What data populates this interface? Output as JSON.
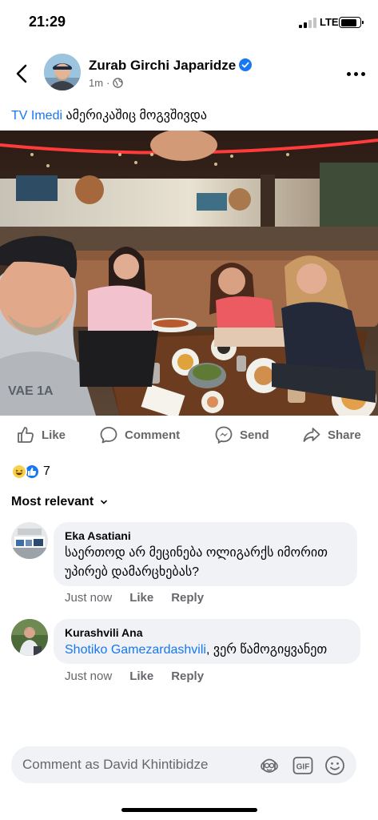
{
  "status_bar": {
    "time": "21:29",
    "network": "LTE"
  },
  "post": {
    "author": "Zurab Girchi Japaridze",
    "meta_time": "1m",
    "tag_text": "TV Imedi",
    "body_text": " ამერიკაშიც მოგვშივდა",
    "actions": {
      "like": "Like",
      "comment": "Comment",
      "send": "Send",
      "share": "Share"
    },
    "reaction_count": "7",
    "sort_label": "Most relevant"
  },
  "comments": [
    {
      "author": "Eka Asatiani",
      "text": "საერთოდ არ მეცინება ოლიგარქს იმორით უპირებ დამარცხებას?",
      "time": "Just now",
      "like": "Like",
      "reply": "Reply"
    },
    {
      "author": "Kurashvili Ana",
      "mention": "Shotiko Gamezardashvili",
      "text": ", ვერ წამოგიყვანეთ",
      "time": "Just now",
      "like": "Like",
      "reply": "Reply"
    }
  ],
  "composer": {
    "placeholder": "Comment as David Khintibidze",
    "gif_label": "GIF"
  },
  "colors": {
    "accent": "#1877f2",
    "secondary_text": "#65676b",
    "bubble": "#f0f2f5"
  },
  "icons": [
    "back-arrow-icon",
    "verified-badge-icon",
    "globe-icon",
    "more-icon",
    "like-icon",
    "comment-icon",
    "messenger-icon",
    "share-icon",
    "haha-reaction-icon",
    "like-reaction-icon",
    "chevron-down-icon",
    "avatar-sticker-icon",
    "gif-icon",
    "emoji-icon"
  ]
}
